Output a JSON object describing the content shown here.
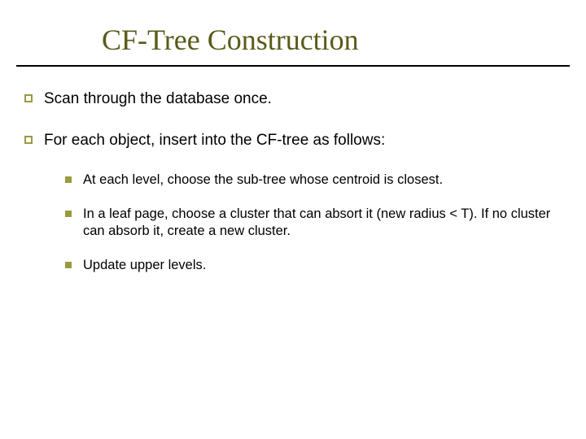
{
  "title": "CF-Tree Construction",
  "bullets": {
    "b0": "Scan through the database once.",
    "b1": "For each object, insert into the CF-tree as follows:",
    "sub0": "At each level, choose the sub-tree whose centroid is closest.",
    "sub1": "In a leaf page, choose a cluster that can absort it (new radius < T). If no cluster can absorb it, create a new cluster.",
    "sub2": "Update upper levels."
  }
}
